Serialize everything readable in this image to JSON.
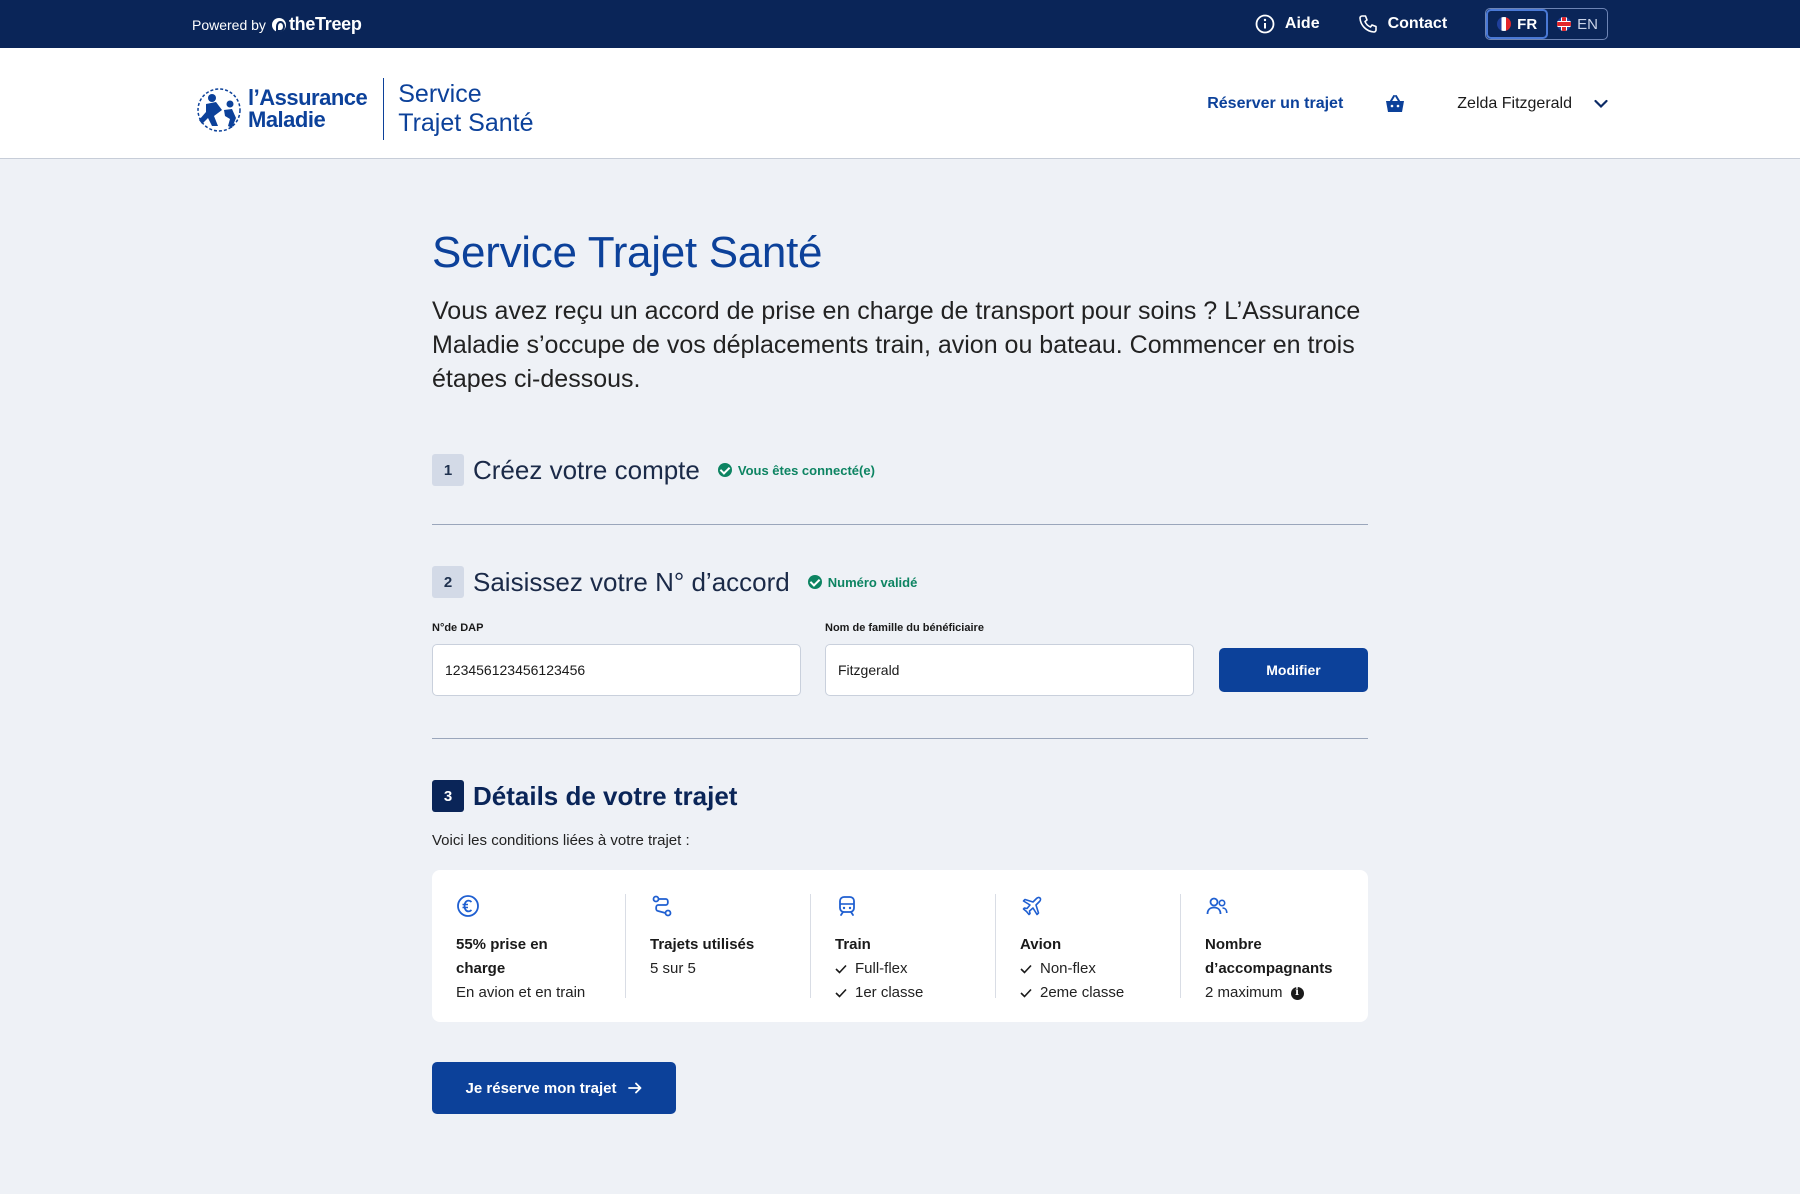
{
  "topbar": {
    "powered_by": "Powered by",
    "brand": "theTreep",
    "help_label": "Aide",
    "contact_label": "Contact",
    "lang_fr": "FR",
    "lang_en": "EN",
    "icons": {
      "help": "info-circle-icon",
      "contact": "phone-icon",
      "fr": "flag-france-icon",
      "en": "flag-uk-icon"
    }
  },
  "header": {
    "logo_line1": "l’Assurance",
    "logo_line2": "Maladie",
    "service_line1": "Service",
    "service_line2": "Trajet Santé",
    "reserve_link": "Réserver un trajet",
    "user_name": "Zelda Fitzgerald",
    "icons": {
      "basket": "basket-icon",
      "user_menu": "chevron-down-icon"
    }
  },
  "main": {
    "title": "Service Trajet Santé",
    "intro": "Vous avez reçu un accord de prise en charge de transport pour soins ? L’Assurance Maladie s’occupe de vos déplacements train, avion ou bateau. Commencer en trois étapes ci-dessous."
  },
  "steps": [
    {
      "number": "1",
      "title": "Créez votre compte",
      "badge": "Vous êtes connecté(e)"
    },
    {
      "number": "2",
      "title": "Saisissez votre N° d’accord",
      "badge": "Numéro validé"
    },
    {
      "number": "3",
      "title": "Détails de votre trajet"
    }
  ],
  "form": {
    "dap_label": "N°de DAP",
    "dap_value": "123456123456123456",
    "name_label": "Nom de famille du bénéficiaire",
    "name_value": "Fitzgerald",
    "modify_button": "Modifier"
  },
  "details": {
    "intro": "Voici les conditions liées à votre trajet :",
    "columns": [
      {
        "icon": "euro-icon",
        "title": "55% prise en charge",
        "lines": [
          "En avion et en train"
        ]
      },
      {
        "icon": "route-icon",
        "title": "Trajets utilisés",
        "lines": [
          "5 sur 5"
        ]
      },
      {
        "icon": "train-icon",
        "title": "Train",
        "lines": [
          "Full-flex",
          "1er classe"
        ]
      },
      {
        "icon": "plane-icon",
        "title": "Avion",
        "lines": [
          "Non-flex",
          "2eme classe"
        ]
      },
      {
        "icon": "people-icon",
        "title": "Nombre d’accompagnants",
        "lines": [
          "2 maximum"
        ]
      }
    ],
    "info_icon": "info-icon"
  },
  "cta": {
    "label": "Je réserve mon trajet",
    "icon": "arrow-right-icon"
  },
  "colors": {
    "navy": "#0a2558",
    "primary": "#0c419a",
    "success": "#0d8462",
    "background": "#eef1f6"
  }
}
